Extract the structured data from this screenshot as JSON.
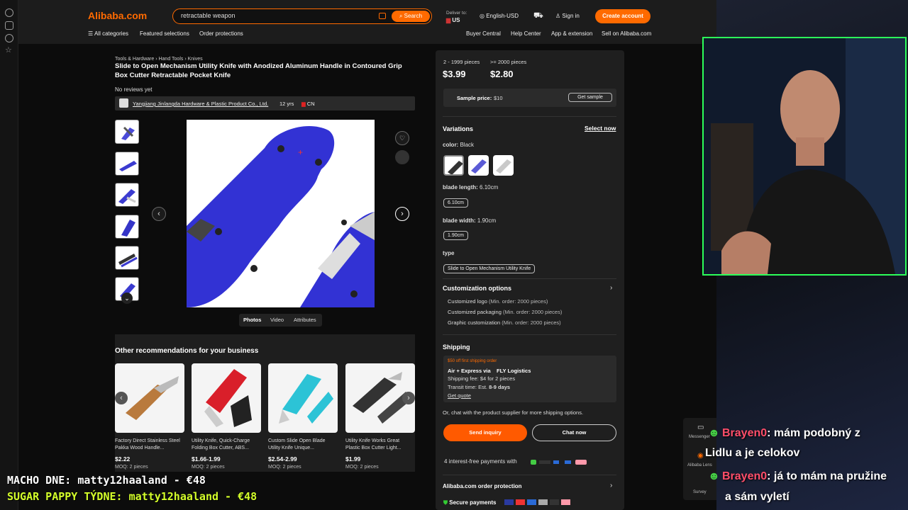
{
  "header": {
    "logo": "Alibaba.com",
    "search_value": "retractable weapon",
    "search_button": "Search",
    "deliver_to_label": "Deliver to:",
    "deliver_to_value": "US",
    "language": "English-USD",
    "sign_in": "Sign in",
    "create_account": "Create account",
    "nav": [
      "All categories",
      "Featured selections",
      "Order protections"
    ],
    "nav_right": [
      "Buyer Central",
      "Help Center",
      "App & extension",
      "Sell on Alibaba.com"
    ]
  },
  "breadcrumb": [
    "Tools & Hardware",
    "Hand Tools",
    "Knives"
  ],
  "product": {
    "title": "Slide to Open Mechanism Utility Knife with Anodized Aluminum Handle in Contoured Grip Box Cutter Retractable Pocket Knife",
    "reviews": "No reviews yet",
    "supplier": "Yangjiang Jinlangda Hardware & Plastic Product Co., Ltd.",
    "years": "12 yrs",
    "country": "CN",
    "media_tabs": [
      "Photos",
      "Video",
      "Attributes"
    ]
  },
  "recommendations": {
    "heading": "Other recommendations for your business",
    "items": [
      {
        "title": "Factory Direct Stainless Steel Pakka Wood Handle...",
        "price": "$2.22",
        "moq": "MOQ: 2 pieces"
      },
      {
        "title": "Utility Knife, Quick-Charge Folding Box Cutter, ABS...",
        "price": "$1.66-1.99",
        "moq": "MOQ: 2 pieces"
      },
      {
        "title": "Custom Slide Open Blade Utility Knife Unique...",
        "price": "$2.54-2.99",
        "moq": "MOQ: 2 pieces"
      },
      {
        "title": "Utility Knife Works Great Plastic Box Cutter Light...",
        "price": "$1.99",
        "moq": "MOQ: 2 pieces"
      }
    ]
  },
  "pricing": {
    "tiers": [
      {
        "range": "2 - 1999 pieces",
        "price": "$3.99"
      },
      {
        "range": ">= 2000 pieces",
        "price": "$2.80"
      }
    ],
    "sample_label": "Sample price:",
    "sample_value": "$10",
    "get_sample": "Get sample"
  },
  "variations": {
    "heading": "Variations",
    "select_now": "Select now",
    "color_label": "color:",
    "color_value": "Black",
    "blade_length_label": "blade length:",
    "blade_length_value": "6.10cm",
    "blade_length_chip": "6.10cm",
    "blade_width_label": "blade width:",
    "blade_width_value": "1.90cm",
    "blade_width_chip": "1.90cm",
    "type_label": "type",
    "type_chip": "Slide to Open Mechanism Utility Knife"
  },
  "customization": {
    "heading": "Customization options",
    "items": [
      {
        "name": "Customized logo",
        "note": "(Min. order: 2000 pieces)"
      },
      {
        "name": "Customized packaging",
        "note": "(Min. order: 2000 pieces)"
      },
      {
        "name": "Graphic customization",
        "note": "(Min. order: 2000 pieces)"
      }
    ]
  },
  "shipping": {
    "heading": "Shipping",
    "promo": "$50 off first shipping order",
    "method_prefix": "Air + Express via",
    "method_carrier": "FLY Logistics",
    "fee": "Shipping fee: $4 for 2 pieces",
    "transit_label": "Transit time: Est.",
    "transit_value": "8-9 days",
    "get_quote": "Get quote",
    "chat_note": "Or, chat with the product supplier for more shipping options."
  },
  "actions": {
    "send_inquiry": "Send inquiry",
    "chat_now": "Chat now",
    "payments": "4 interest-free payments with",
    "protection": "Alibaba.com order protection",
    "secure": "Secure payments"
  },
  "side_widget": [
    "Messenger",
    "Alibaba Lens",
    "Survey"
  ],
  "stream": {
    "chat": [
      {
        "name": "Brayen0",
        "msg": ": mám podobný z"
      },
      {
        "name": "",
        "msg": "Lidlu a je celokov"
      },
      {
        "name": "Brayen0",
        "msg": ": já to mám na pružine"
      },
      {
        "name": "",
        "msg": "a sám vyletí"
      }
    ],
    "overlay_line1": "MACHO DNE: matty12haaland - €48",
    "overlay_line2": "SUGAR PAPPY TÝDNE: matty12haaland - €48"
  },
  "colors": {
    "accent": "#ff6a00",
    "webcam_border": "#2cff5a",
    "chat_name": "#ff4e6a",
    "overlay1": "#ffffff",
    "overlay2": "#d4ff2a",
    "swatch_selected": "#5b5bd6",
    "promo": "#ff6a00"
  },
  "icons": [
    "history-icon",
    "bookmark-icon",
    "clock-icon",
    "star-icon",
    "camera-icon",
    "globe-icon",
    "cart-icon",
    "user-icon",
    "heart-icon",
    "chevron-left-icon",
    "chevron-right-icon",
    "chevron-down-icon",
    "shield-icon",
    "message-icon"
  ]
}
